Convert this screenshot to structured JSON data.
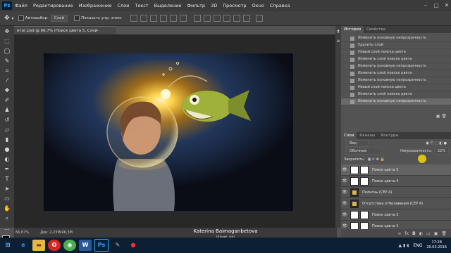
{
  "menu": {
    "logo": "Ps",
    "items": [
      "Файл",
      "Редактирование",
      "Изображение",
      "Слои",
      "Текст",
      "Выделение",
      "Фильтр",
      "3D",
      "Просмотр",
      "Окно",
      "Справка"
    ]
  },
  "options": {
    "autoselect_label": "Автовыбор:",
    "autoselect_value": "Слой",
    "show_controls_label": "Показать упр. элем."
  },
  "document": {
    "tab_label": "итог.psd @ 66,7% (Поиск цвета 5, Слой-маска/8) *"
  },
  "status": {
    "zoom": "66,67%",
    "doc_size": "Док: 2,23M/46,3M"
  },
  "panels": {
    "history_tabs": [
      "История",
      "Свойства"
    ],
    "history_items": [
      "Изменить основную непрозрачность",
      "Удалить слой",
      "Новый слой поиска цвета",
      "Изменить слой поиска цвета",
      "Изменить основную непрозрачность",
      "Изменить слой поиска цвета",
      "Изменить основную непрозрачность",
      "Новый слой поиска цвета",
      "Изменить слой поиска цвета",
      "Изменить основную непрозрачность"
    ],
    "layers_tabs": [
      "Слои",
      "Каналы",
      "Контуры"
    ],
    "filter_kind": "Вид",
    "blend_mode": "Обычные",
    "opacity_label": "Непрозрачность:",
    "opacity_value": "22%",
    "lock_label": "Закрепить:",
    "layers": [
      {
        "name": "Поиск цвета 5",
        "type": "adjustment",
        "selected": true
      },
      {
        "name": "Поиск цвета 4",
        "type": "adjustment",
        "selected": false
      },
      {
        "name": "Полночь (СЕР 4)",
        "type": "fx",
        "selected": false
      },
      {
        "name": "Отсутствие отбеливания (СЕР 4)",
        "type": "fx",
        "selected": false
      },
      {
        "name": "Поиск цвета 3",
        "type": "adjustment",
        "selected": false
      },
      {
        "name": "Поиск цвета 1",
        "type": "adjustment",
        "selected": false
      }
    ]
  },
  "credit": {
    "line1": "Katerina Baimaganbetova",
    "line2": "lillsok_kiii"
  },
  "taskbar": {
    "lang": "ENG",
    "time": "17:28",
    "date": "20.03.2016",
    "apps": [
      "start",
      "ie",
      "explorer",
      "opera",
      "chrome",
      "word",
      "photoshop",
      "paint",
      "bandicam"
    ]
  },
  "colors": {
    "accent": "#31a8ff",
    "highlight_cursor": "#f2d900",
    "taskbar": "#0c1f33",
    "panel": "#535353"
  }
}
